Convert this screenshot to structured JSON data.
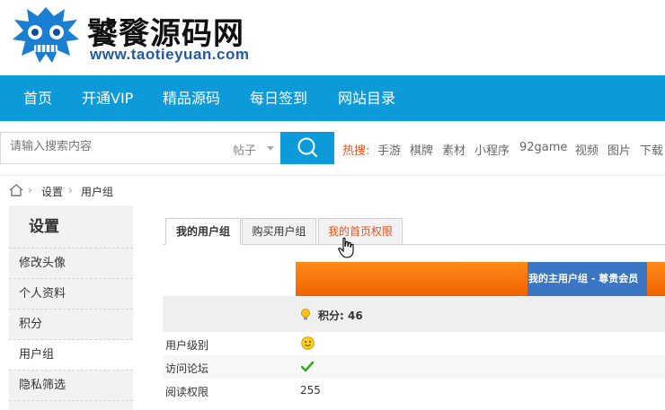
{
  "header": {
    "logo_title": "饕餮源码网",
    "logo_url": "www.taotieyuan.com",
    "logo_icon": "taotie-mascot-icon"
  },
  "nav": {
    "items": [
      "首页",
      "开通VIP",
      "精品源码",
      "每日签到",
      "网站目录"
    ]
  },
  "search": {
    "placeholder": "请输入搜索内容",
    "type": "帖子",
    "hot_label": "热搜:",
    "hot_links": [
      "手游",
      "棋牌",
      "素材",
      "小程序",
      "92game",
      "视频",
      "图片",
      "下载"
    ]
  },
  "breadcrumb": {
    "items": [
      "设置",
      "用户组"
    ]
  },
  "sidebar": {
    "title": "设置",
    "items": [
      "修改头像",
      "个人资料",
      "积分",
      "用户组",
      "隐私筛选"
    ],
    "active": "用户组"
  },
  "tabs": [
    "我的用户组",
    "购买用户组",
    "我的首页权限"
  ],
  "table": {
    "group_header": "我的主用户组 - 尊贵会员",
    "points": "积分: 46",
    "rows": [
      {
        "label": "用户级别",
        "value": ""
      },
      {
        "label": "访问论坛",
        "value": ""
      },
      {
        "label": "阅读权限",
        "value": "255"
      }
    ]
  },
  "colors": {
    "nav_bg": "#0d9ad8",
    "accent_orange": "#f06400",
    "header_blue": "#3b76c4",
    "hot_red": "#e8541e"
  }
}
